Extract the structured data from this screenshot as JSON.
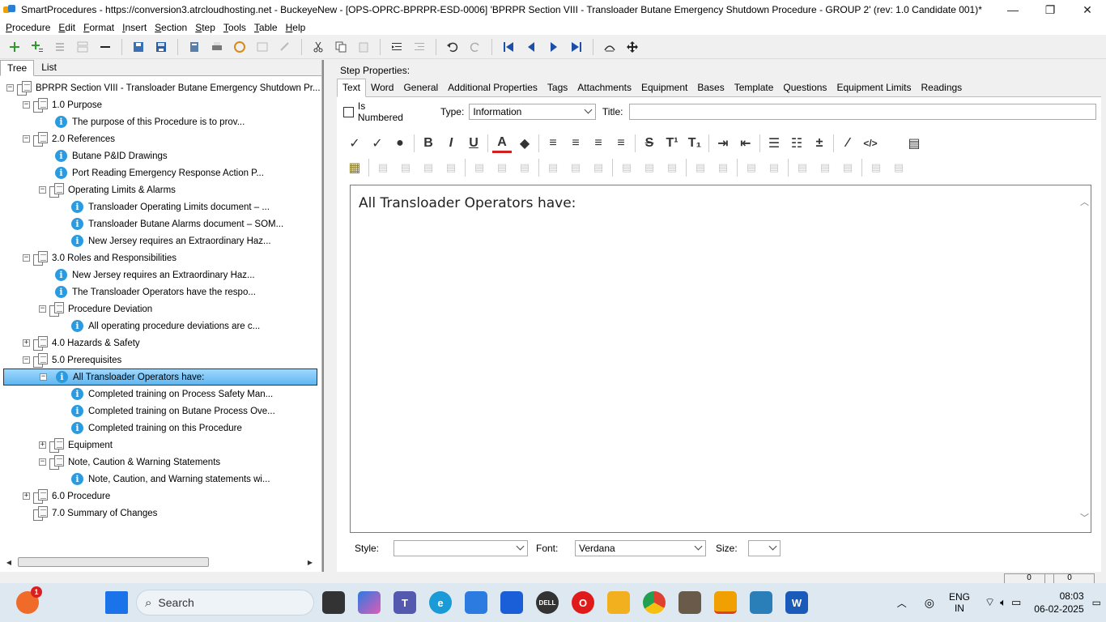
{
  "window": {
    "title": "SmartProcedures - https://conversion3.atrcloudhosting.net - BuckeyeNew - [OPS-OPRC-BPRPR-ESD-0006] 'BPRPR Section VIII - Transloader Butane Emergency Shutdown Procedure - GROUP 2' (rev: 1.0 Candidate 001)*",
    "controls": {
      "minimize": "—",
      "maximize": "❐",
      "close": "✕"
    }
  },
  "menu": [
    {
      "label": "Procedure",
      "accel": "P",
      "rest": "rocedure"
    },
    {
      "label": "Edit",
      "accel": "E",
      "rest": "dit"
    },
    {
      "label": "Format",
      "accel": "F",
      "rest": "ormat"
    },
    {
      "label": "Insert",
      "accel": "I",
      "rest": "nsert"
    },
    {
      "label": "Section",
      "accel": "S",
      "rest": "ection"
    },
    {
      "label": "Step",
      "accel": "S",
      "rest": "tep"
    },
    {
      "label": "Tools",
      "accel": "T",
      "rest": "ools"
    },
    {
      "label": "Table",
      "accel": "T",
      "rest": "able"
    },
    {
      "label": "Help",
      "accel": "H",
      "rest": "elp"
    }
  ],
  "left_tabs": {
    "tree": "Tree",
    "list": "List"
  },
  "tree": [
    {
      "level": 0,
      "type": "section",
      "expander": "−",
      "label": "BPRPR Section VIII - Transloader Butane Emergency Shutdown Pr..."
    },
    {
      "level": 1,
      "type": "section",
      "expander": "−",
      "label": "1.0 Purpose"
    },
    {
      "level": 2,
      "type": "info",
      "expander": "",
      "label": "The purpose of this Procedure is to prov..."
    },
    {
      "level": 1,
      "type": "section",
      "expander": "−",
      "label": "2.0 References"
    },
    {
      "level": 2,
      "type": "info",
      "expander": "",
      "label": "Butane P&ID Drawings"
    },
    {
      "level": 2,
      "type": "info",
      "expander": "",
      "label": "Port Reading Emergency Response Action P..."
    },
    {
      "level": 2,
      "type": "section",
      "expander": "−",
      "label": "Operating Limits & Alarms"
    },
    {
      "level": 3,
      "type": "info",
      "expander": "",
      "label": "Transloader Operating Limits document – ..."
    },
    {
      "level": 3,
      "type": "info",
      "expander": "",
      "label": "Transloader Butane Alarms document – SOM..."
    },
    {
      "level": 3,
      "type": "info",
      "expander": "",
      "label": "New Jersey requires an Extraordinary Haz..."
    },
    {
      "level": 1,
      "type": "section",
      "expander": "−",
      "label": "3.0 Roles and Responsibilities"
    },
    {
      "level": 2,
      "type": "info",
      "expander": "",
      "label": "New Jersey requires an Extraordinary Haz..."
    },
    {
      "level": 2,
      "type": "info",
      "expander": "",
      "label": "The Transloader Operators have the respo..."
    },
    {
      "level": 2,
      "type": "section",
      "expander": "−",
      "label": "Procedure Deviation"
    },
    {
      "level": 3,
      "type": "info",
      "expander": "",
      "label": "All operating procedure deviations are c..."
    },
    {
      "level": 1,
      "type": "section",
      "expander": "+",
      "label": "4.0 Hazards & Safety"
    },
    {
      "level": 1,
      "type": "section",
      "expander": "−",
      "label": "5.0 Prerequisites"
    },
    {
      "level": 2,
      "type": "info",
      "expander": "−",
      "label": "All Transloader Operators have:",
      "selected": true
    },
    {
      "level": 3,
      "type": "info",
      "expander": "",
      "label": "Completed training on Process Safety Man..."
    },
    {
      "level": 3,
      "type": "info",
      "expander": "",
      "label": "Completed training on Butane Process Ove..."
    },
    {
      "level": 3,
      "type": "info",
      "expander": "",
      "label": "Completed training on this Procedure"
    },
    {
      "level": 2,
      "type": "section",
      "expander": "+",
      "label": "Equipment"
    },
    {
      "level": 2,
      "type": "section",
      "expander": "−",
      "label": "Note, Caution & Warning Statements"
    },
    {
      "level": 3,
      "type": "info",
      "expander": "",
      "label": "Note, Caution, and Warning statements wi..."
    },
    {
      "level": 1,
      "type": "section",
      "expander": "+",
      "label": "6.0 Procedure"
    },
    {
      "level": 1,
      "type": "section",
      "expander": "",
      "label": "7.0 Summary of Changes"
    }
  ],
  "step_props": {
    "heading": "Step Properties:",
    "tabs": [
      "Text",
      "Word",
      "General",
      "Additional Properties",
      "Tags",
      "Attachments",
      "Equipment",
      "Bases",
      "Template",
      "Questions",
      "Equipment Limits",
      "Readings"
    ],
    "is_numbered_label": "Is Numbered",
    "type_label": "Type:",
    "type_value": "Information",
    "title_label": "Title:",
    "title_value": ""
  },
  "format_row1": [
    {
      "name": "spellcheck-icon",
      "glyph": "✓"
    },
    {
      "name": "spellcheck-all-icon",
      "glyph": "✓"
    },
    {
      "name": "highlight-icon",
      "glyph": "●"
    },
    {
      "sep": true
    },
    {
      "name": "bold-button",
      "glyph": "B"
    },
    {
      "name": "italic-button",
      "glyph": "I"
    },
    {
      "name": "underline-button",
      "glyph": "U"
    },
    {
      "sep": true
    },
    {
      "name": "font-color-icon",
      "glyph": "A"
    },
    {
      "name": "fill-color-icon",
      "glyph": "◆"
    },
    {
      "sep": true
    },
    {
      "name": "align-left-icon",
      "glyph": "≡"
    },
    {
      "name": "align-center-icon",
      "glyph": "≡"
    },
    {
      "name": "align-right-icon",
      "glyph": "≡"
    },
    {
      "name": "justify-icon",
      "glyph": "≡"
    },
    {
      "sep": true
    },
    {
      "name": "strikethrough-button",
      "glyph": "S"
    },
    {
      "name": "superscript-button",
      "glyph": "T¹"
    },
    {
      "name": "subscript-button",
      "glyph": "T₁"
    },
    {
      "sep": true
    },
    {
      "name": "indent-icon",
      "glyph": "⇥"
    },
    {
      "name": "outdent-icon",
      "glyph": "⇤"
    },
    {
      "sep": true
    },
    {
      "name": "bullet-list-icon",
      "glyph": "☰"
    },
    {
      "name": "numbered-list-icon",
      "glyph": "☷"
    },
    {
      "name": "insert-symbol-icon",
      "glyph": "±"
    },
    {
      "sep": true
    },
    {
      "name": "magic-wand-icon",
      "glyph": "⁄"
    },
    {
      "name": "html-source-icon",
      "glyph": "</>"
    },
    {
      "name": "print-icon",
      "glyph": "▤"
    }
  ],
  "editor": {
    "content": "All Transloader Operators have:"
  },
  "style_row": {
    "style_label": "Style:",
    "style_value": "",
    "font_label": "Font:",
    "font_value": "Verdana",
    "size_label": "Size:",
    "size_value": ""
  },
  "status": {
    "cell1": "0",
    "cell2": "0"
  },
  "taskbar": {
    "search_placeholder": "Search",
    "notification_badge": "1",
    "lang_top": "ENG",
    "lang_bottom": "IN",
    "time": "08:03",
    "date": "06-02-2025"
  },
  "colors": {
    "selection": "#5fb6f0",
    "info_icon": "#2a9be0",
    "taskbar": "#dde8f0"
  }
}
